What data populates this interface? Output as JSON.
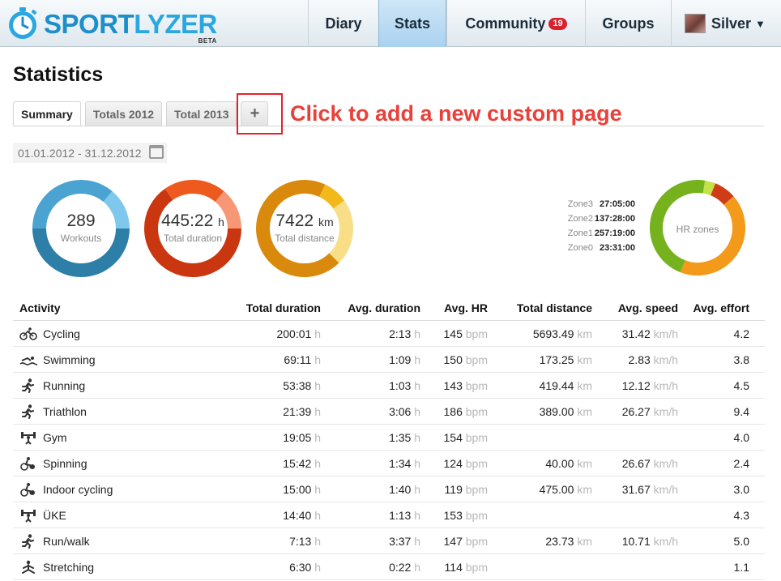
{
  "app": {
    "logo_text_a": "SPORT",
    "logo_text_b": "LYZER",
    "logo_beta": "BETA"
  },
  "nav": {
    "diary": "Diary",
    "stats": "Stats",
    "community": "Community",
    "community_badge": "19",
    "groups": "Groups",
    "user": "Silver"
  },
  "page": {
    "title": "Statistics",
    "tabs": [
      "Summary",
      "Totals 2012",
      "Total 2013"
    ],
    "add_tab": "+",
    "callout": "Click to add a new custom page",
    "date_range": "01.01.2012 - 31.12.2012"
  },
  "summary": {
    "workouts_value": "289",
    "workouts_label": "Workouts",
    "duration_value": "445:22",
    "duration_unit": "h",
    "duration_label": "Total duration",
    "distance_value": "7422",
    "distance_unit": "km",
    "distance_label": "Total distance",
    "hr_label": "HR zones"
  },
  "zones": [
    {
      "name": "Zone3",
      "value": "27:05:00"
    },
    {
      "name": "Zone2",
      "value": "137:28:00"
    },
    {
      "name": "Zone1",
      "value": "257:19:00"
    },
    {
      "name": "Zone0",
      "value": "23:31:00"
    }
  ],
  "colors": {
    "workouts": [
      "#2e7fa8",
      "#4aa3d1",
      "#7ec8ee"
    ],
    "duration": [
      "#c9360f",
      "#ee5a1e",
      "#f79775"
    ],
    "distance": [
      "#d98a0c",
      "#f3b91b",
      "#f9de88"
    ],
    "hr": [
      "#76b21e",
      "#c5e048",
      "#cf3d17",
      "#f39a1b"
    ]
  },
  "table": {
    "headers": {
      "activity": "Activity",
      "total_duration": "Total duration",
      "avg_duration": "Avg. duration",
      "avg_hr": "Avg. HR",
      "total_distance": "Total distance",
      "avg_speed": "Avg. speed",
      "avg_effort": "Avg. effort"
    },
    "units": {
      "h": "h",
      "bpm": "bpm",
      "km": "km",
      "kmh": "km/h"
    },
    "rows": [
      {
        "icon": "cycling-icon",
        "activity": "Cycling",
        "total_duration": "200:01",
        "avg_duration": "2:13",
        "avg_hr": "145",
        "total_distance": "5693.49",
        "avg_speed": "31.42",
        "avg_effort": "4.2"
      },
      {
        "icon": "swimming-icon",
        "activity": "Swimming",
        "total_duration": "69:11",
        "avg_duration": "1:09",
        "avg_hr": "150",
        "total_distance": "173.25",
        "avg_speed": "2.83",
        "avg_effort": "3.8"
      },
      {
        "icon": "running-icon",
        "activity": "Running",
        "total_duration": "53:38",
        "avg_duration": "1:03",
        "avg_hr": "143",
        "total_distance": "419.44",
        "avg_speed": "12.12",
        "avg_effort": "4.5"
      },
      {
        "icon": "running-icon",
        "activity": "Triathlon",
        "total_duration": "21:39",
        "avg_duration": "3:06",
        "avg_hr": "186",
        "total_distance": "389.00",
        "avg_speed": "26.27",
        "avg_effort": "9.4"
      },
      {
        "icon": "gym-icon",
        "activity": "Gym",
        "total_duration": "19:05",
        "avg_duration": "1:35",
        "avg_hr": "154",
        "total_distance": "",
        "avg_speed": "",
        "avg_effort": "4.0"
      },
      {
        "icon": "spinning-icon",
        "activity": "Spinning",
        "total_duration": "15:42",
        "avg_duration": "1:34",
        "avg_hr": "124",
        "total_distance": "40.00",
        "avg_speed": "26.67",
        "avg_effort": "2.4"
      },
      {
        "icon": "spinning-icon",
        "activity": "Indoor cycling",
        "total_duration": "15:00",
        "avg_duration": "1:40",
        "avg_hr": "119",
        "total_distance": "475.00",
        "avg_speed": "31.67",
        "avg_effort": "3.0"
      },
      {
        "icon": "gym-icon",
        "activity": "ÜKE",
        "total_duration": "14:40",
        "avg_duration": "1:13",
        "avg_hr": "153",
        "total_distance": "",
        "avg_speed": "",
        "avg_effort": "4.3"
      },
      {
        "icon": "running-icon",
        "activity": "Run/walk",
        "total_duration": "7:13",
        "avg_duration": "3:37",
        "avg_hr": "147",
        "total_distance": "23.73",
        "avg_speed": "10.71",
        "avg_effort": "5.0"
      },
      {
        "icon": "stretching-icon",
        "activity": "Stretching",
        "total_duration": "6:30",
        "avg_duration": "0:22",
        "avg_hr": "114",
        "total_distance": "",
        "avg_speed": "",
        "avg_effort": "1.1"
      }
    ]
  }
}
